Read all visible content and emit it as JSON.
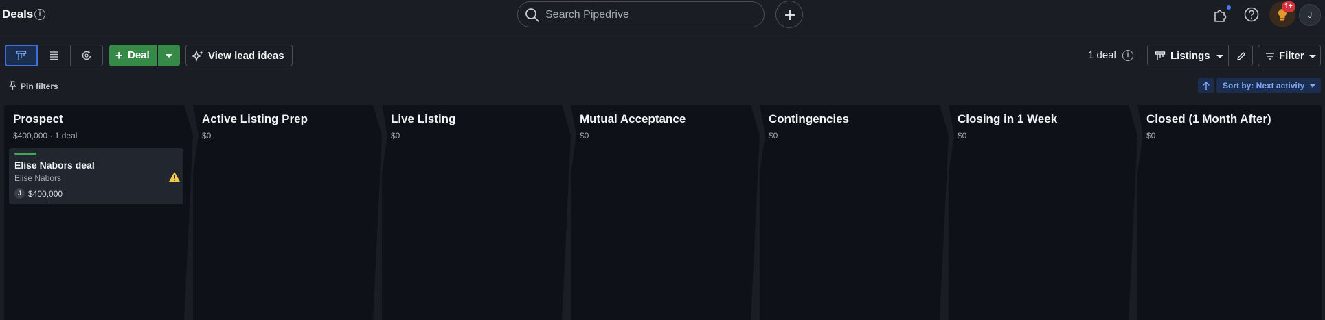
{
  "header": {
    "title": "Deals",
    "search_placeholder": "Search Pipedrive",
    "tips_badge": "1+",
    "user_initial": "J"
  },
  "toolbar": {
    "add_deal_label": "Deal",
    "lead_ideas_label": "View lead ideas",
    "deal_count": "1 deal",
    "pipeline_label": "Listings",
    "filter_label": "Filter"
  },
  "subbar": {
    "pin_filters_label": "Pin filters",
    "sort_label": "Sort by: Next activity"
  },
  "stages": [
    {
      "name": "Prospect",
      "summary": "$400,000 · 1 deal"
    },
    {
      "name": "Active Listing Prep",
      "summary": "$0"
    },
    {
      "name": "Live Listing",
      "summary": "$0"
    },
    {
      "name": "Mutual Acceptance",
      "summary": "$0"
    },
    {
      "name": "Contingencies",
      "summary": "$0"
    },
    {
      "name": "Closing in 1 Week",
      "summary": "$0"
    },
    {
      "name": "Closed (1 Month After)",
      "summary": "$0"
    }
  ],
  "cards": [
    {
      "title": "Elise Nabors deal",
      "person": "Elise Nabors",
      "owner_initial": "J",
      "value": "$400,000",
      "status_color": "#3da85b",
      "warning_icon": "warning-triangle-icon"
    }
  ],
  "colors": {
    "background": "#1a1d24",
    "column": "#0e1117",
    "accent": "#3d6fd8",
    "add_button": "#368a48",
    "warning": "#f2c94c"
  }
}
